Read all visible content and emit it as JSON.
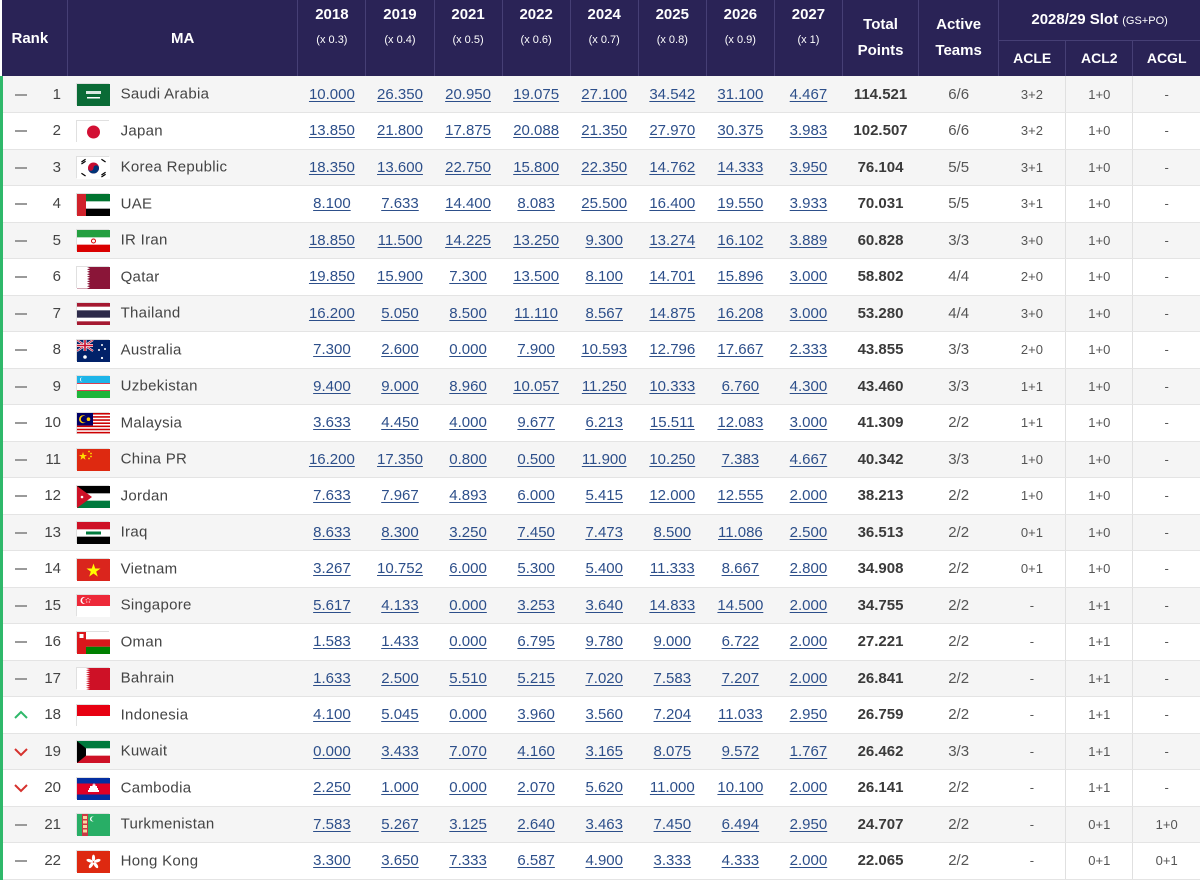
{
  "table": {
    "header": {
      "rank": "Rank",
      "ma": "MA",
      "years": [
        {
          "year": "2018",
          "mult": "(x 0.3)"
        },
        {
          "year": "2019",
          "mult": "(x 0.4)"
        },
        {
          "year": "2021",
          "mult": "(x 0.5)"
        },
        {
          "year": "2022",
          "mult": "(x 0.6)"
        },
        {
          "year": "2024",
          "mult": "(x 0.7)"
        },
        {
          "year": "2025",
          "mult": "(x 0.8)"
        },
        {
          "year": "2026",
          "mult": "(x 0.9)"
        },
        {
          "year": "2027",
          "mult": "(x 1)"
        }
      ],
      "total_line1": "Total",
      "total_line2": "Points",
      "active_line1": "Active",
      "active_line2": "Teams",
      "slot_title": "2028/29 Slot",
      "slot_note": "(GS+PO)",
      "slot_cols": [
        "ACLE",
        "ACL2",
        "ACGL"
      ]
    },
    "rows": [
      {
        "trend": "same",
        "rank": "1",
        "flag": "saudi-arabia",
        "name": "Saudi Arabia",
        "years": [
          "10.000",
          "26.350",
          "20.950",
          "19.075",
          "27.100",
          "34.542",
          "31.100",
          "4.467"
        ],
        "total": "114.521",
        "active": "6/6",
        "acle": "3+2",
        "acl2": "1+0",
        "acgl": "-"
      },
      {
        "trend": "same",
        "rank": "2",
        "flag": "japan",
        "name": "Japan",
        "years": [
          "13.850",
          "21.800",
          "17.875",
          "20.088",
          "21.350",
          "27.970",
          "30.375",
          "3.983"
        ],
        "total": "102.507",
        "active": "6/6",
        "acle": "3+2",
        "acl2": "1+0",
        "acgl": "-"
      },
      {
        "trend": "same",
        "rank": "3",
        "flag": "korea-republic",
        "name": "Korea Republic",
        "years": [
          "18.350",
          "13.600",
          "22.750",
          "15.800",
          "22.350",
          "14.762",
          "14.333",
          "3.950"
        ],
        "total": "76.104",
        "active": "5/5",
        "acle": "3+1",
        "acl2": "1+0",
        "acgl": "-"
      },
      {
        "trend": "same",
        "rank": "4",
        "flag": "uae",
        "name": "UAE",
        "years": [
          "8.100",
          "7.633",
          "14.400",
          "8.083",
          "25.500",
          "16.400",
          "19.550",
          "3.933"
        ],
        "total": "70.031",
        "active": "5/5",
        "acle": "3+1",
        "acl2": "1+0",
        "acgl": "-"
      },
      {
        "trend": "same",
        "rank": "5",
        "flag": "ir-iran",
        "name": "IR Iran",
        "years": [
          "18.850",
          "11.500",
          "14.225",
          "13.250",
          "9.300",
          "13.274",
          "16.102",
          "3.889"
        ],
        "total": "60.828",
        "active": "3/3",
        "acle": "3+0",
        "acl2": "1+0",
        "acgl": "-"
      },
      {
        "trend": "same",
        "rank": "6",
        "flag": "qatar",
        "name": "Qatar",
        "years": [
          "19.850",
          "15.900",
          "7.300",
          "13.500",
          "8.100",
          "14.701",
          "15.896",
          "3.000"
        ],
        "total": "58.802",
        "active": "4/4",
        "acle": "2+0",
        "acl2": "1+0",
        "acgl": "-"
      },
      {
        "trend": "same",
        "rank": "7",
        "flag": "thailand",
        "name": "Thailand",
        "years": [
          "16.200",
          "5.050",
          "8.500",
          "11.110",
          "8.567",
          "14.875",
          "16.208",
          "3.000"
        ],
        "total": "53.280",
        "active": "4/4",
        "acle": "3+0",
        "acl2": "1+0",
        "acgl": "-"
      },
      {
        "trend": "same",
        "rank": "8",
        "flag": "australia",
        "name": "Australia",
        "years": [
          "7.300",
          "2.600",
          "0.000",
          "7.900",
          "10.593",
          "12.796",
          "17.667",
          "2.333"
        ],
        "total": "43.855",
        "active": "3/3",
        "acle": "2+0",
        "acl2": "1+0",
        "acgl": "-"
      },
      {
        "trend": "same",
        "rank": "9",
        "flag": "uzbekistan",
        "name": "Uzbekistan",
        "years": [
          "9.400",
          "9.000",
          "8.960",
          "10.057",
          "11.250",
          "10.333",
          "6.760",
          "4.300"
        ],
        "total": "43.460",
        "active": "3/3",
        "acle": "1+1",
        "acl2": "1+0",
        "acgl": "-"
      },
      {
        "trend": "same",
        "rank": "10",
        "flag": "malaysia",
        "name": "Malaysia",
        "years": [
          "3.633",
          "4.450",
          "4.000",
          "9.677",
          "6.213",
          "15.511",
          "12.083",
          "3.000"
        ],
        "total": "41.309",
        "active": "2/2",
        "acle": "1+1",
        "acl2": "1+0",
        "acgl": "-"
      },
      {
        "trend": "same",
        "rank": "11",
        "flag": "china-pr",
        "name": "China PR",
        "years": [
          "16.200",
          "17.350",
          "0.800",
          "0.500",
          "11.900",
          "10.250",
          "7.383",
          "4.667"
        ],
        "total": "40.342",
        "active": "3/3",
        "acle": "1+0",
        "acl2": "1+0",
        "acgl": "-"
      },
      {
        "trend": "same",
        "rank": "12",
        "flag": "jordan",
        "name": "Jordan",
        "years": [
          "7.633",
          "7.967",
          "4.893",
          "6.000",
          "5.415",
          "12.000",
          "12.555",
          "2.000"
        ],
        "total": "38.213",
        "active": "2/2",
        "acle": "1+0",
        "acl2": "1+0",
        "acgl": "-"
      },
      {
        "trend": "same",
        "rank": "13",
        "flag": "iraq",
        "name": "Iraq",
        "years": [
          "8.633",
          "8.300",
          "3.250",
          "7.450",
          "7.473",
          "8.500",
          "11.086",
          "2.500"
        ],
        "total": "36.513",
        "active": "2/2",
        "acle": "0+1",
        "acl2": "1+0",
        "acgl": "-"
      },
      {
        "trend": "same",
        "rank": "14",
        "flag": "vietnam",
        "name": "Vietnam",
        "years": [
          "3.267",
          "10.752",
          "6.000",
          "5.300",
          "5.400",
          "11.333",
          "8.667",
          "2.800"
        ],
        "total": "34.908",
        "active": "2/2",
        "acle": "0+1",
        "acl2": "1+0",
        "acgl": "-"
      },
      {
        "trend": "same",
        "rank": "15",
        "flag": "singapore",
        "name": "Singapore",
        "years": [
          "5.617",
          "4.133",
          "0.000",
          "3.253",
          "3.640",
          "14.833",
          "14.500",
          "2.000"
        ],
        "total": "34.755",
        "active": "2/2",
        "acle": "-",
        "acl2": "1+1",
        "acgl": "-"
      },
      {
        "trend": "same",
        "rank": "16",
        "flag": "oman",
        "name": "Oman",
        "years": [
          "1.583",
          "1.433",
          "0.000",
          "6.795",
          "9.780",
          "9.000",
          "6.722",
          "2.000"
        ],
        "total": "27.221",
        "active": "2/2",
        "acle": "-",
        "acl2": "1+1",
        "acgl": "-"
      },
      {
        "trend": "same",
        "rank": "17",
        "flag": "bahrain",
        "name": "Bahrain",
        "years": [
          "1.633",
          "2.500",
          "5.510",
          "5.215",
          "7.020",
          "7.583",
          "7.207",
          "2.000"
        ],
        "total": "26.841",
        "active": "2/2",
        "acle": "-",
        "acl2": "1+1",
        "acgl": "-"
      },
      {
        "trend": "up",
        "rank": "18",
        "flag": "indonesia",
        "name": "Indonesia",
        "years": [
          "4.100",
          "5.045",
          "0.000",
          "3.960",
          "3.560",
          "7.204",
          "11.033",
          "2.950"
        ],
        "total": "26.759",
        "active": "2/2",
        "acle": "-",
        "acl2": "1+1",
        "acgl": "-"
      },
      {
        "trend": "down",
        "rank": "19",
        "flag": "kuwait",
        "name": "Kuwait",
        "years": [
          "0.000",
          "3.433",
          "7.070",
          "4.160",
          "3.165",
          "8.075",
          "9.572",
          "1.767"
        ],
        "total": "26.462",
        "active": "3/3",
        "acle": "-",
        "acl2": "1+1",
        "acgl": "-"
      },
      {
        "trend": "down",
        "rank": "20",
        "flag": "cambodia",
        "name": "Cambodia",
        "years": [
          "2.250",
          "1.000",
          "0.000",
          "2.070",
          "5.620",
          "11.000",
          "10.100",
          "2.000"
        ],
        "total": "26.141",
        "active": "2/2",
        "acle": "-",
        "acl2": "1+1",
        "acgl": "-"
      },
      {
        "trend": "same",
        "rank": "21",
        "flag": "turkmenistan",
        "name": "Turkmenistan",
        "years": [
          "7.583",
          "5.267",
          "3.125",
          "2.640",
          "3.463",
          "7.450",
          "6.494",
          "2.950"
        ],
        "total": "24.707",
        "active": "2/2",
        "acle": "-",
        "acl2": "0+1",
        "acgl": "1+0"
      },
      {
        "trend": "same",
        "rank": "22",
        "flag": "hong-kong",
        "name": "Hong Kong",
        "years": [
          "3.300",
          "3.650",
          "7.333",
          "6.587",
          "4.900",
          "3.333",
          "4.333",
          "2.000"
        ],
        "total": "22.065",
        "active": "2/2",
        "acle": "-",
        "acl2": "0+1",
        "acgl": "0+1"
      }
    ]
  },
  "colors": {
    "header_bg": "#2a2356",
    "link": "#2d4f8a",
    "trend_up": "#2fb86a",
    "trend_down": "#d6322e",
    "trend_same": "#9a9a9a",
    "row_accent": "#2fb86a"
  }
}
